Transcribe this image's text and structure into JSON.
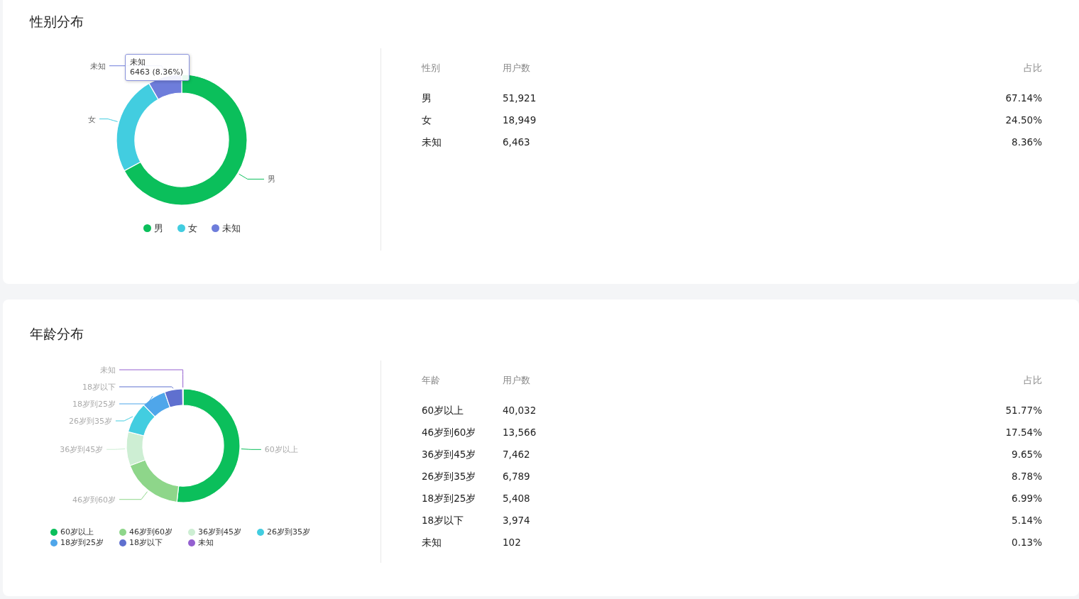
{
  "sections": [
    {
      "title": "性别分布",
      "chart": {
        "chart_data": {
          "type": "donut",
          "categories": [
            "男",
            "女",
            "未知"
          ],
          "values": [
            67.14,
            24.5,
            8.36
          ],
          "colors": [
            "#0bbf5b",
            "#42cde0",
            "#6e7ddb"
          ]
        },
        "tooltip": {
          "title": "未知",
          "value": "6463 (8.36%)"
        },
        "legend": [
          {
            "label": "男",
            "color": "#0bbf5b"
          },
          {
            "label": "女",
            "color": "#42cde0"
          },
          {
            "label": "未知",
            "color": "#6e7ddb"
          }
        ]
      },
      "table": {
        "columns": [
          "性别",
          "用户数",
          "占比"
        ],
        "rows": [
          [
            "男",
            "51,921",
            "67.14%"
          ],
          [
            "女",
            "18,949",
            "24.50%"
          ],
          [
            "未知",
            "6,463",
            "8.36%"
          ]
        ]
      }
    },
    {
      "title": "年龄分布",
      "chart": {
        "chart_data": {
          "type": "donut",
          "categories": [
            "60岁以上",
            "46岁到60岁",
            "36岁到45岁",
            "26岁到35岁",
            "18岁到25岁",
            "18岁以下",
            "未知"
          ],
          "values": [
            51.77,
            17.54,
            9.65,
            8.78,
            6.99,
            5.14,
            0.13
          ],
          "colors": [
            "#0bbf5b",
            "#8ed68a",
            "#cdeed3",
            "#42cde0",
            "#4fa6ea",
            "#5f70cf",
            "#9460d0"
          ]
        },
        "legend": [
          {
            "label": "60岁以上",
            "color": "#0bbf5b"
          },
          {
            "label": "46岁到60岁",
            "color": "#8ed68a"
          },
          {
            "label": "36岁到45岁",
            "color": "#cdeed3"
          },
          {
            "label": "26岁到35岁",
            "color": "#42cde0"
          },
          {
            "label": "18岁到25岁",
            "color": "#4fa6ea"
          },
          {
            "label": "18岁以下",
            "color": "#5f70cf"
          },
          {
            "label": "未知",
            "color": "#9460d0"
          }
        ]
      },
      "table": {
        "columns": [
          "年龄",
          "用户数",
          "占比"
        ],
        "rows": [
          [
            "60岁以上",
            "40,032",
            "51.77%"
          ],
          [
            "46岁到60岁",
            "13,566",
            "17.54%"
          ],
          [
            "36岁到45岁",
            "7,462",
            "9.65%"
          ],
          [
            "26岁到35岁",
            "6,789",
            "8.78%"
          ],
          [
            "18岁到25岁",
            "5,408",
            "6.99%"
          ],
          [
            "18岁以下",
            "3,974",
            "5.14%"
          ],
          [
            "未知",
            "102",
            "0.13%"
          ]
        ]
      }
    }
  ]
}
